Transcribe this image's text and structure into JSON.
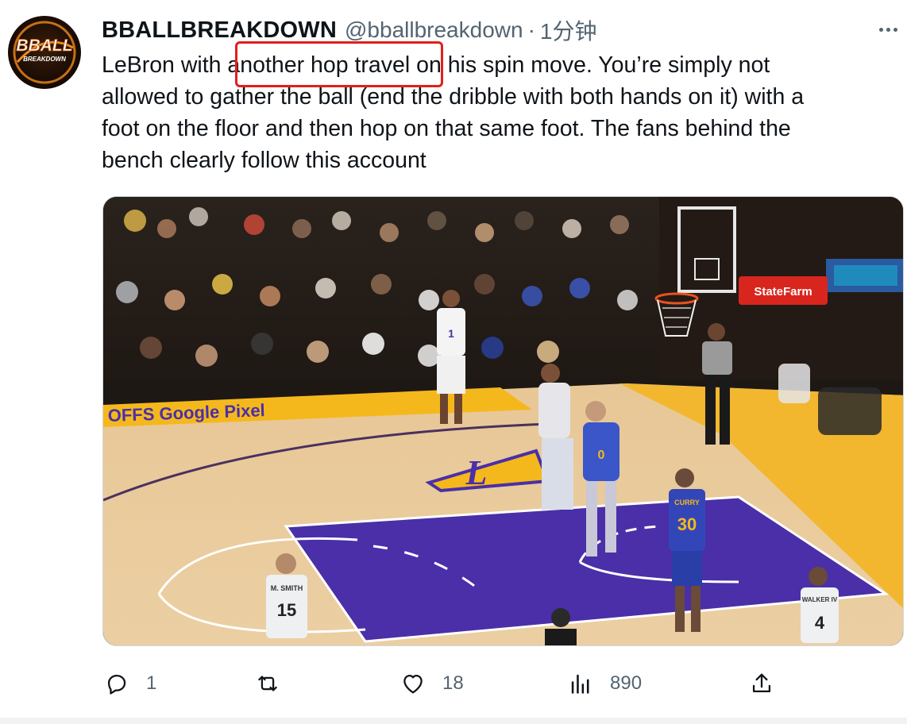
{
  "tweet": {
    "display_name": "BBALLBREAKDOWN",
    "handle": "@bballbreakdown",
    "separator": "·",
    "time": "1分钟",
    "avatar_text_top": "BBALL",
    "avatar_text_bottom": "BREAKDOWN",
    "text_lines": [
      "LeBron with ",
      "another hop travel",
      " on his spin move. You’re simply not",
      "allowed to gather the ball (end the dribble with both hands on it) with a",
      "foot on the floor and then hop on that same foot. The fans behind the",
      "bench clearly follow this account"
    ]
  },
  "media": {
    "sponsor_sign": "StateFarm",
    "court_banner": "OFFS   Google Pixel",
    "jersey_numbers": [
      "1",
      "30",
      "15",
      "4",
      "0"
    ],
    "player_name_30": "CURRY",
    "player_name_15": "M. SMITH",
    "player_name_4": "WALKER IV",
    "court_logo": "L"
  },
  "actions": {
    "replies": "1",
    "retweets": "",
    "likes": "18",
    "views": "890"
  },
  "colors": {
    "text": "#0f1419",
    "muted": "#536471",
    "highlight_box": "#e0201a",
    "court_purple": "#4a2fa8",
    "court_gold": "#f5b81c"
  },
  "icons": [
    "more-icon",
    "reply-icon",
    "retweet-icon",
    "like-icon",
    "views-icon",
    "share-icon"
  ]
}
